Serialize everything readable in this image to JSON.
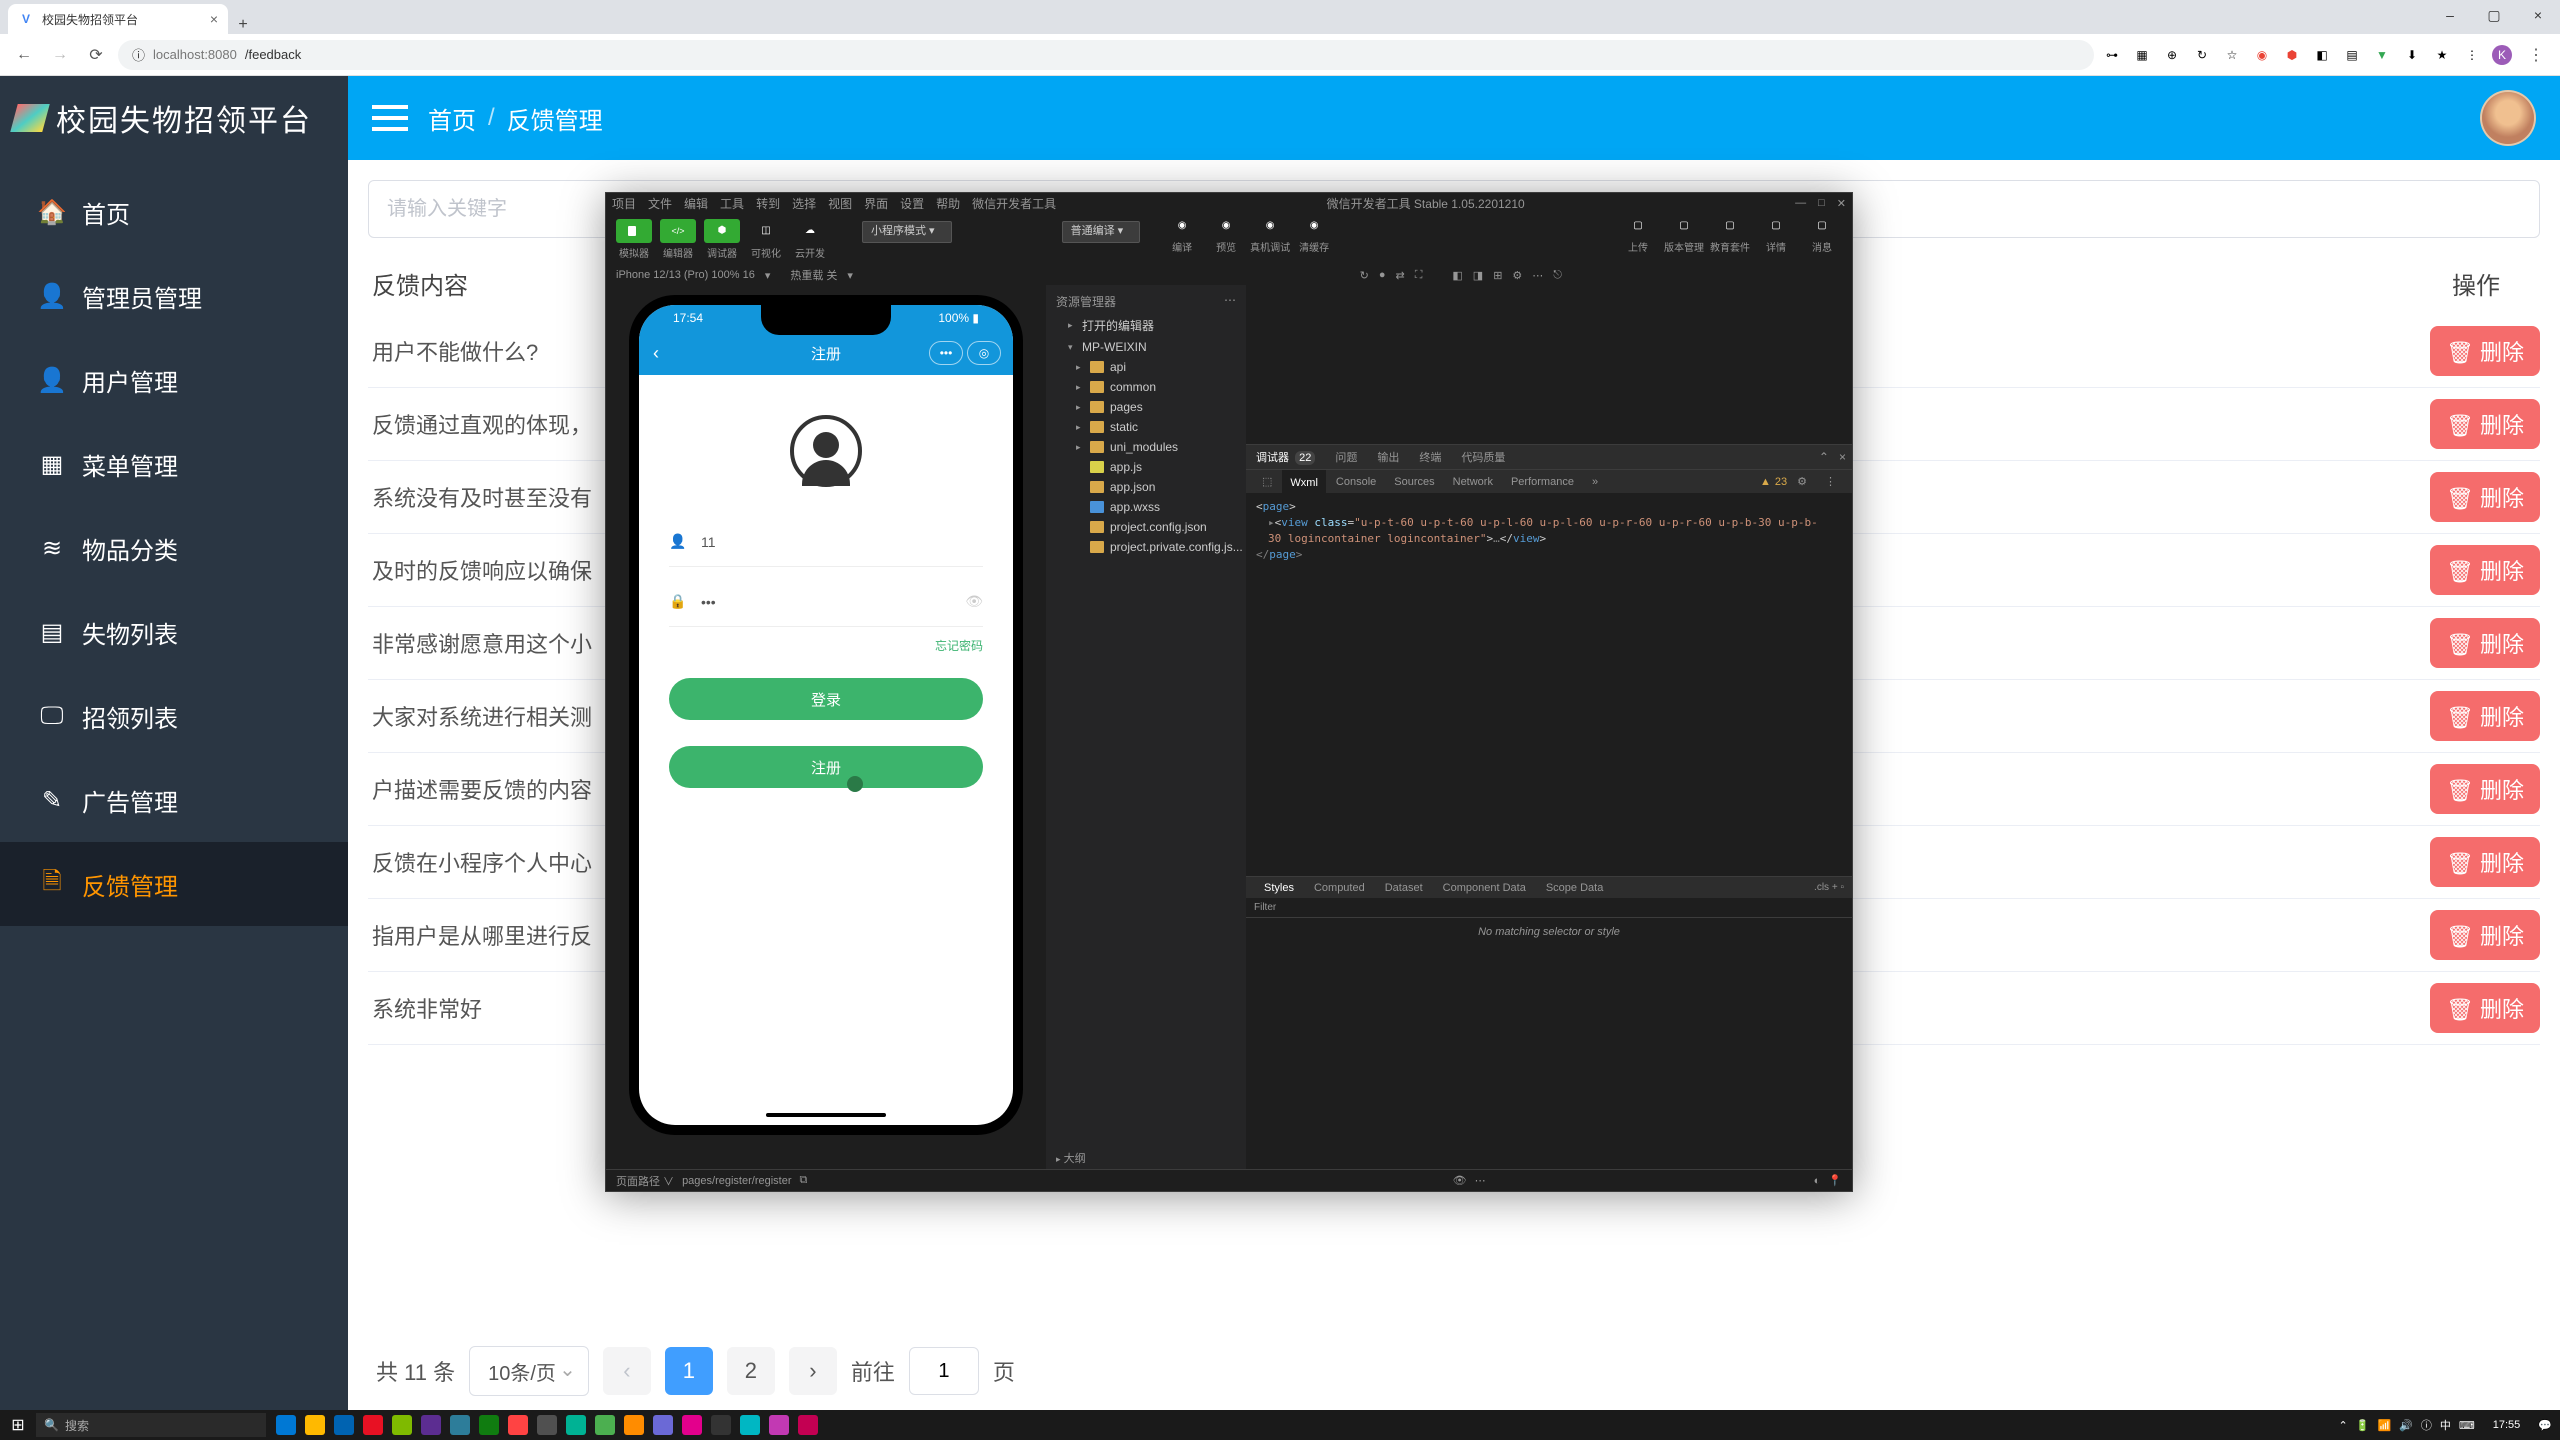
{
  "browser": {
    "tab_title": "校园失物招领平台",
    "url_prefix": "localhost:8080",
    "url_path": "/feedback"
  },
  "header": {
    "logo": "校园失物招领平台",
    "breadcrumb": [
      "首页",
      "反馈管理"
    ]
  },
  "sidebar": {
    "items": [
      {
        "icon": "home",
        "label": "首页"
      },
      {
        "icon": "user",
        "label": "管理员管理"
      },
      {
        "icon": "user",
        "label": "用户管理"
      },
      {
        "icon": "grid",
        "label": "菜单管理"
      },
      {
        "icon": "tags",
        "label": "物品分类"
      },
      {
        "icon": "list",
        "label": "失物列表"
      },
      {
        "icon": "monitor",
        "label": "招领列表"
      },
      {
        "icon": "edit",
        "label": "广告管理"
      },
      {
        "icon": "doc",
        "label": "反馈管理"
      }
    ],
    "active_index": 8
  },
  "search": {
    "placeholder": "请输入关键字"
  },
  "table": {
    "header_content": "反馈内容",
    "header_action": "操作",
    "rows": [
      "用户不能做什么?",
      "反馈通过直观的体现，",
      "系统没有及时甚至没有",
      "及时的反馈响应以确保",
      "非常感谢愿意用这个小",
      "大家对系统进行相关测",
      "户描述需要反馈的内容",
      "反馈在小程序个人中心",
      "指用户是从哪里进行反",
      "系统非常好"
    ],
    "delete_label": "删除"
  },
  "pagination": {
    "total_label": "共 11 条",
    "per_page": "10条/页",
    "pages": [
      "1",
      "2"
    ],
    "active_page": 0,
    "jump_prefix": "前往",
    "jump_value": "1",
    "jump_suffix": "页"
  },
  "ide": {
    "menu": [
      "项目",
      "文件",
      "编辑",
      "工具",
      "转到",
      "选择",
      "视图",
      "界面",
      "设置",
      "帮助",
      "微信开发者工具"
    ],
    "title": "微信开发者工具 Stable 1.05.2201210",
    "left_tools": [
      "模拟器",
      "编辑器",
      "调试器",
      "可视化",
      "云开发"
    ],
    "compile_mode": "小程序模式",
    "compile_type": "普通编译",
    "toolbar_mid": [
      "编译",
      "预览",
      "真机调试",
      "清缓存"
    ],
    "toolbar_right": [
      "上传",
      "版本管理",
      "教育套件",
      "详情",
      "消息"
    ],
    "device": "iPhone 12/13 (Pro) 100% 16",
    "device_extra": "热重载 关",
    "tree_title": "资源管理器",
    "tree": {
      "root1": "打开的编辑器",
      "root2": "MP-WEIXIN",
      "folders": [
        "api",
        "common",
        "pages",
        "static",
        "uni_modules"
      ],
      "files": [
        "app.js",
        "app.json",
        "app.wxss",
        "project.config.json",
        "project.private.config.js..."
      ],
      "footer": "大纲"
    },
    "debugger_tab": "调试器",
    "debugger_badge": "22",
    "top_tabs": [
      "问题",
      "输出",
      "终端",
      "代码质量"
    ],
    "inspector_tabs": [
      "Wxml",
      "Console",
      "Sources",
      "Network",
      "Performance"
    ],
    "warn_count": "23",
    "code": {
      "l1_tag": "page",
      "l2_prefix": "▸",
      "l2_tag": "view",
      "l2_class": "u-p-t-60 u-p-t-60 u-p-l-60 u-p-l-60 u-p-r-60 u-p-r-60 u-p-b-30 u-p-b-",
      "l3": "30 logincontainer logincontainer",
      "l3_tail": "…",
      "l4": "page"
    },
    "styles_tabs": [
      "Styles",
      "Computed",
      "Dataset",
      "Component Data",
      "Scope Data"
    ],
    "cls": ".cls",
    "filter": "Filter",
    "nomatch": "No matching selector or style",
    "footer_left": "页面路径 ∨",
    "footer_path": "pages/register/register"
  },
  "phone": {
    "time": "17:54",
    "battery": "100%",
    "title": "注册",
    "username": "11",
    "password": "•••",
    "forgot": "忘记密码",
    "login_btn": "登录",
    "register_btn": "注册"
  },
  "taskbar": {
    "search": "搜索",
    "time": "17:55"
  }
}
